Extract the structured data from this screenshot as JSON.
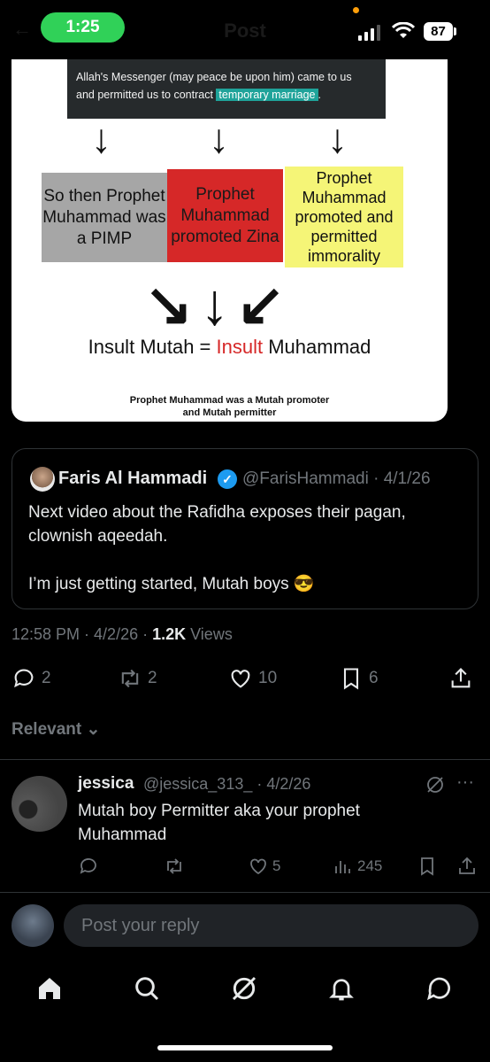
{
  "status_bar": {
    "time": "1:25",
    "battery": "87",
    "title": "Post"
  },
  "media": {
    "hadith_line1": "Allah's Messenger (may peace be upon him) came to us",
    "hadith_line2_pre": "and permitted us to contract ",
    "hadith_highlight": "temporary marriage",
    "hadith_line2_post": ".",
    "arrow": "↓",
    "box_gray": "So then Prophet Muhammad was a PIMP",
    "box_red": "Prophet Muhammad promoted Zina",
    "box_yellow": "Prophet Muhammad promoted and permitted immorality",
    "big_arrows": "↘↓↙",
    "equation_left": "Insult Mutah = ",
    "equation_mid": "Insult",
    "equation_right": " Muhammad",
    "caption_line1": "Prophet Muhammad was a Mutah promoter",
    "caption_line2": "and Mutah permitter"
  },
  "quote": {
    "name": "Faris Al Hammadi",
    "handle": "@FarisHammadi · 4/1/26",
    "text_line1": "Next video about the Rafidha exposes their pagan, clownish aqeedah.",
    "text_line2": "I’m just getting started, Mutah boys 😎"
  },
  "meta": {
    "time": "12:58 PM · 4/2/26 · ",
    "views_count": "1.2K",
    "views_label": " Views"
  },
  "actions": {
    "replies": "2",
    "reposts": "2",
    "likes": "10",
    "bookmarks": "6"
  },
  "relevant_label": "Relevant ⌄",
  "reply": {
    "name": "jessica",
    "handle": "@jessica_313_ · 4/2/26",
    "text": "Mutah boy Permitter aka your prophet Muhammad",
    "likes": "5",
    "views": "245"
  },
  "composer": {
    "placeholder": "Post your reply"
  },
  "colors": {
    "accent": "#1d9bf0",
    "background": "#000000",
    "muted": "#71767b"
  }
}
